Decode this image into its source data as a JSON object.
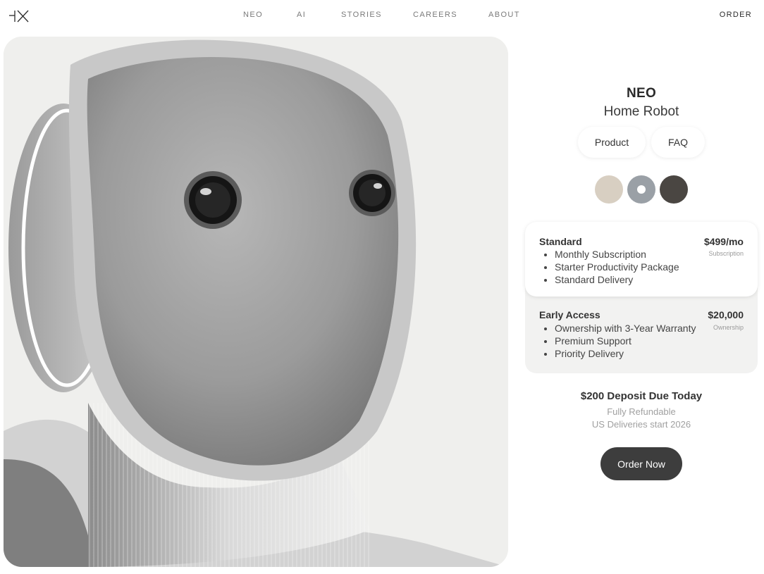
{
  "nav": {
    "logo_alt": "1X",
    "links": [
      "NEO",
      "AI",
      "STORIES",
      "CAREERS",
      "ABOUT"
    ],
    "order": "ORDER"
  },
  "product": {
    "name": "NEO",
    "subtitle": "Home Robot",
    "tabs": [
      "Product",
      "FAQ"
    ],
    "colors": [
      {
        "name": "beige",
        "hex": "#d8cfc2"
      },
      {
        "name": "gray",
        "hex": "#9aa0a6",
        "selected": true
      },
      {
        "name": "dark",
        "hex": "#4a4642"
      }
    ]
  },
  "plans": [
    {
      "name": "Standard",
      "price": "$499/mo",
      "type": "Subscription",
      "selected": true,
      "features": [
        "Monthly Subscription",
        "Starter Productivity Package",
        "Standard Delivery"
      ]
    },
    {
      "name": "Early Access",
      "price": "$20,000",
      "type": "Ownership",
      "selected": false,
      "features": [
        "Ownership with 3-Year Warranty",
        "Premium Support",
        "Priority Delivery"
      ]
    }
  ],
  "checkout": {
    "deposit": "$200 Deposit Due Today",
    "refundable": "Fully Refundable",
    "delivery": "US Deliveries start 2026",
    "cta": "Order Now"
  }
}
